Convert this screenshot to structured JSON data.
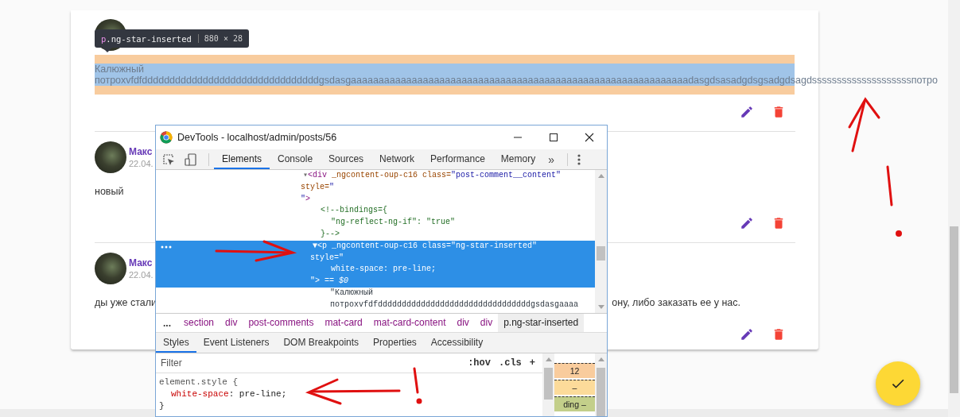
{
  "inspect_tooltip": {
    "tag": "p",
    "class_name": ".ng-star-inserted",
    "size": "880 × 28"
  },
  "comments": [
    {
      "highlighted": true,
      "lines": [
        "Калюжный",
        "потрохvfdfddddddddddddddddddddddddddddddddgsdasgaaaaaaaaaaaaaaaaaaaaaaaaaaaaaaaaaaaaaaaaaaaaaaaaaaaaaaaaaaaaadasgdsasadgdsgsadgdsagdssssssssssssssssssssпотро"
      ]
    },
    {
      "author": "Макс",
      "date": "22.04.",
      "highlighted": false,
      "lines": [
        "новый"
      ]
    },
    {
      "author": "Макс",
      "date": "22.04.",
      "highlighted": false,
      "fragments": [
        "ды уже стали",
        "ону, либо заказать ее у нас."
      ]
    }
  ],
  "devtools": {
    "title": "DevTools - localhost/admin/posts/56",
    "tabs": [
      {
        "label": "Elements",
        "selected": true
      },
      {
        "label": "Console",
        "selected": false
      },
      {
        "label": "Sources",
        "selected": false
      },
      {
        "label": "Network",
        "selected": false
      },
      {
        "label": "Performance",
        "selected": false
      },
      {
        "label": "Memory",
        "selected": false
      }
    ],
    "more_tabs": "»",
    "dom_tree": [
      {
        "selected": false,
        "lines": [
          {
            "kind": "open",
            "segs": [
              {
                "text": "▾",
                "kind": "arrow"
              },
              {
                "text": "<div",
                "kind": "tag"
              },
              {
                "text": " _ngcontent-oup-c16 class=",
                "kind": "attr"
              },
              {
                "text": "\"post-comment__content\"",
                "kind": "value"
              }
            ]
          },
          {
            "kind": "cont",
            "segs": [
              {
                "text": "style=",
                "kind": "attr"
              },
              {
                "text": "\"",
                "kind": "value"
              }
            ]
          },
          {
            "kind": "cont",
            "segs": [
              {
                "text": "\"",
                "kind": "value"
              },
              {
                "text": ">",
                "kind": "tag"
              }
            ]
          }
        ],
        "children": [
          {
            "selected": false,
            "lines": [
              {
                "kind": "leaf",
                "segs": [
                  {
                    "text": "<!--bindings={",
                    "kind": "comment"
                  }
                ]
              },
              {
                "kind": "prop",
                "segs": [
                  {
                    "text": "\"ng-reflect-ng-if\": \"true\"",
                    "kind": "comment"
                  }
                ]
              },
              {
                "kind": "leaf",
                "segs": [
                  {
                    "text": "}-->",
                    "kind": "comment"
                  }
                ]
              }
            ]
          },
          {
            "selected": true,
            "lines": [
              {
                "kind": "open",
                "segs": [
                  {
                    "text": "▼",
                    "kind": "arrow"
                  },
                  {
                    "text": "<p",
                    "kind": "tag"
                  },
                  {
                    "text": " _ngcontent-oup-c16 class=",
                    "kind": "attr"
                  },
                  {
                    "text": "\"ng-star-inserted\"",
                    "kind": "value"
                  }
                ]
              },
              {
                "kind": "cont",
                "segs": [
                  {
                    "text": "style=",
                    "kind": "attr"
                  },
                  {
                    "text": "\"",
                    "kind": "value"
                  }
                ]
              },
              {
                "kind": "prop",
                "segs": [
                  {
                    "text": "white-space: pre-line;",
                    "kind": "value"
                  }
                ]
              },
              {
                "kind": "cont",
                "segs": [
                  {
                    "text": "\"",
                    "kind": "value"
                  },
                  {
                    "text": ">",
                    "kind": "tag"
                  },
                  {
                    "text": " == $0",
                    "kind": "dim"
                  }
                ]
              }
            ],
            "children": [
              {
                "selected": false,
                "lines": [
                  {
                    "kind": "leaf",
                    "segs": [
                      {
                        "text": "\"Калюжный",
                        "kind": "text"
                      }
                    ]
                  },
                  {
                    "kind": "leaf",
                    "segs": [
                      {
                        "text": "потрохvfdfddddddddddddddddddddddddddddddddgsdasgaaaa",
                        "kind": "text"
                      }
                    ]
                  }
                ]
              }
            ]
          }
        ]
      }
    ],
    "breadcrumbs": {
      "more": "...",
      "items": [
        {
          "label": "section",
          "selected": false
        },
        {
          "label": "div",
          "selected": false
        },
        {
          "label": "post-comments",
          "selected": false
        },
        {
          "label": "mat-card",
          "selected": false
        },
        {
          "label": "mat-card-content",
          "selected": false
        },
        {
          "label": "div",
          "selected": false
        },
        {
          "label": "div",
          "selected": false
        },
        {
          "label": "p.ng-star-inserted",
          "selected": true
        }
      ]
    },
    "panel_tabs": [
      {
        "label": "Styles",
        "selected": true
      },
      {
        "label": "Event Listeners",
        "selected": false
      },
      {
        "label": "DOM Breakpoints",
        "selected": false
      },
      {
        "label": "Properties",
        "selected": false
      },
      {
        "label": "Accessibility",
        "selected": false
      }
    ],
    "filter": {
      "placeholder": "Filter"
    },
    "filter_buttons": [
      ":hov",
      ".cls",
      "+"
    ],
    "style_rule": {
      "selector": "element.style {",
      "declarations": [
        {
          "property": "white-space",
          "value": ": pre-line;"
        }
      ],
      "close": "}"
    },
    "box_model": [
      {
        "text": "12",
        "color": "#f9cc9d"
      },
      {
        "text": "–",
        "color": "#fcdb9a"
      },
      {
        "text": "ding –",
        "color": "#c3cf8a"
      }
    ]
  }
}
